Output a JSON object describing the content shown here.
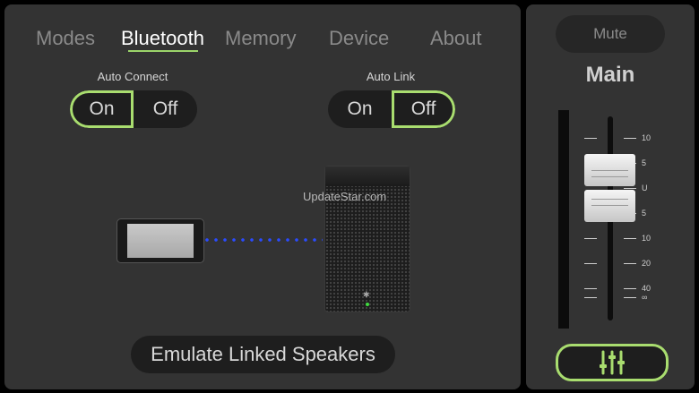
{
  "tabs": [
    {
      "label": "Modes",
      "active": false
    },
    {
      "label": "Bluetooth",
      "active": true
    },
    {
      "label": "Memory",
      "active": false
    },
    {
      "label": "Device",
      "active": false
    },
    {
      "label": "About",
      "active": false
    }
  ],
  "auto_connect": {
    "label": "Auto Connect",
    "on_label": "On",
    "off_label": "Off",
    "selected": "On"
  },
  "auto_link": {
    "label": "Auto Link",
    "on_label": "On",
    "off_label": "Off",
    "selected": "Off"
  },
  "watermark": "UpdateStar.com",
  "emulate_button": "Emulate Linked Speakers",
  "mixer": {
    "mute_label": "Mute",
    "channel_name": "Main",
    "scale": [
      "10",
      "5",
      "U",
      "5",
      "10",
      "20",
      "40",
      "∞"
    ],
    "accent_color": "#a9dd6f"
  },
  "icons": {
    "phone": "phone-icon",
    "speaker": "speaker-icon",
    "eq": "sliders-icon"
  }
}
